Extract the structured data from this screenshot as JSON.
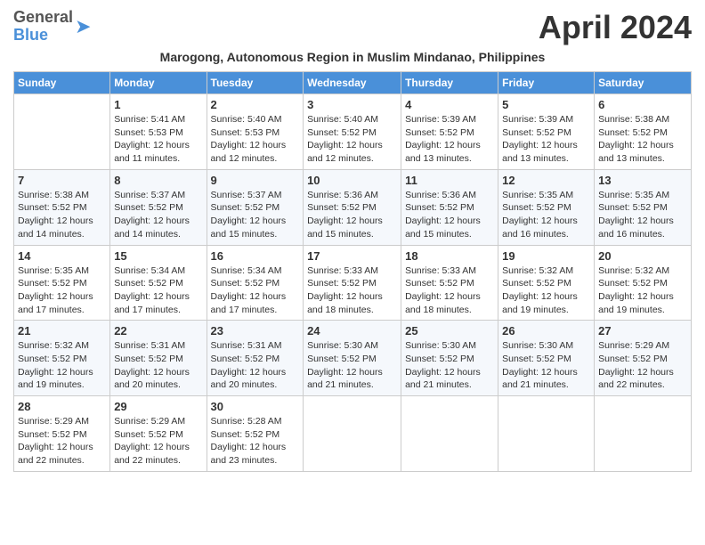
{
  "header": {
    "logo_general": "General",
    "logo_blue": "Blue",
    "month_title": "April 2024",
    "subtitle": "Marogong, Autonomous Region in Muslim Mindanao, Philippines"
  },
  "days_of_week": [
    "Sunday",
    "Monday",
    "Tuesday",
    "Wednesday",
    "Thursday",
    "Friday",
    "Saturday"
  ],
  "weeks": [
    [
      {
        "day": "",
        "sunrise": "",
        "sunset": "",
        "daylight": ""
      },
      {
        "day": "1",
        "sunrise": "Sunrise: 5:41 AM",
        "sunset": "Sunset: 5:53 PM",
        "daylight": "Daylight: 12 hours and 11 minutes."
      },
      {
        "day": "2",
        "sunrise": "Sunrise: 5:40 AM",
        "sunset": "Sunset: 5:53 PM",
        "daylight": "Daylight: 12 hours and 12 minutes."
      },
      {
        "day": "3",
        "sunrise": "Sunrise: 5:40 AM",
        "sunset": "Sunset: 5:52 PM",
        "daylight": "Daylight: 12 hours and 12 minutes."
      },
      {
        "day": "4",
        "sunrise": "Sunrise: 5:39 AM",
        "sunset": "Sunset: 5:52 PM",
        "daylight": "Daylight: 12 hours and 13 minutes."
      },
      {
        "day": "5",
        "sunrise": "Sunrise: 5:39 AM",
        "sunset": "Sunset: 5:52 PM",
        "daylight": "Daylight: 12 hours and 13 minutes."
      },
      {
        "day": "6",
        "sunrise": "Sunrise: 5:38 AM",
        "sunset": "Sunset: 5:52 PM",
        "daylight": "Daylight: 12 hours and 13 minutes."
      }
    ],
    [
      {
        "day": "7",
        "sunrise": "Sunrise: 5:38 AM",
        "sunset": "Sunset: 5:52 PM",
        "daylight": "Daylight: 12 hours and 14 minutes."
      },
      {
        "day": "8",
        "sunrise": "Sunrise: 5:37 AM",
        "sunset": "Sunset: 5:52 PM",
        "daylight": "Daylight: 12 hours and 14 minutes."
      },
      {
        "day": "9",
        "sunrise": "Sunrise: 5:37 AM",
        "sunset": "Sunset: 5:52 PM",
        "daylight": "Daylight: 12 hours and 15 minutes."
      },
      {
        "day": "10",
        "sunrise": "Sunrise: 5:36 AM",
        "sunset": "Sunset: 5:52 PM",
        "daylight": "Daylight: 12 hours and 15 minutes."
      },
      {
        "day": "11",
        "sunrise": "Sunrise: 5:36 AM",
        "sunset": "Sunset: 5:52 PM",
        "daylight": "Daylight: 12 hours and 15 minutes."
      },
      {
        "day": "12",
        "sunrise": "Sunrise: 5:35 AM",
        "sunset": "Sunset: 5:52 PM",
        "daylight": "Daylight: 12 hours and 16 minutes."
      },
      {
        "day": "13",
        "sunrise": "Sunrise: 5:35 AM",
        "sunset": "Sunset: 5:52 PM",
        "daylight": "Daylight: 12 hours and 16 minutes."
      }
    ],
    [
      {
        "day": "14",
        "sunrise": "Sunrise: 5:35 AM",
        "sunset": "Sunset: 5:52 PM",
        "daylight": "Daylight: 12 hours and 17 minutes."
      },
      {
        "day": "15",
        "sunrise": "Sunrise: 5:34 AM",
        "sunset": "Sunset: 5:52 PM",
        "daylight": "Daylight: 12 hours and 17 minutes."
      },
      {
        "day": "16",
        "sunrise": "Sunrise: 5:34 AM",
        "sunset": "Sunset: 5:52 PM",
        "daylight": "Daylight: 12 hours and 17 minutes."
      },
      {
        "day": "17",
        "sunrise": "Sunrise: 5:33 AM",
        "sunset": "Sunset: 5:52 PM",
        "daylight": "Daylight: 12 hours and 18 minutes."
      },
      {
        "day": "18",
        "sunrise": "Sunrise: 5:33 AM",
        "sunset": "Sunset: 5:52 PM",
        "daylight": "Daylight: 12 hours and 18 minutes."
      },
      {
        "day": "19",
        "sunrise": "Sunrise: 5:32 AM",
        "sunset": "Sunset: 5:52 PM",
        "daylight": "Daylight: 12 hours and 19 minutes."
      },
      {
        "day": "20",
        "sunrise": "Sunrise: 5:32 AM",
        "sunset": "Sunset: 5:52 PM",
        "daylight": "Daylight: 12 hours and 19 minutes."
      }
    ],
    [
      {
        "day": "21",
        "sunrise": "Sunrise: 5:32 AM",
        "sunset": "Sunset: 5:52 PM",
        "daylight": "Daylight: 12 hours and 19 minutes."
      },
      {
        "day": "22",
        "sunrise": "Sunrise: 5:31 AM",
        "sunset": "Sunset: 5:52 PM",
        "daylight": "Daylight: 12 hours and 20 minutes."
      },
      {
        "day": "23",
        "sunrise": "Sunrise: 5:31 AM",
        "sunset": "Sunset: 5:52 PM",
        "daylight": "Daylight: 12 hours and 20 minutes."
      },
      {
        "day": "24",
        "sunrise": "Sunrise: 5:30 AM",
        "sunset": "Sunset: 5:52 PM",
        "daylight": "Daylight: 12 hours and 21 minutes."
      },
      {
        "day": "25",
        "sunrise": "Sunrise: 5:30 AM",
        "sunset": "Sunset: 5:52 PM",
        "daylight": "Daylight: 12 hours and 21 minutes."
      },
      {
        "day": "26",
        "sunrise": "Sunrise: 5:30 AM",
        "sunset": "Sunset: 5:52 PM",
        "daylight": "Daylight: 12 hours and 21 minutes."
      },
      {
        "day": "27",
        "sunrise": "Sunrise: 5:29 AM",
        "sunset": "Sunset: 5:52 PM",
        "daylight": "Daylight: 12 hours and 22 minutes."
      }
    ],
    [
      {
        "day": "28",
        "sunrise": "Sunrise: 5:29 AM",
        "sunset": "Sunset: 5:52 PM",
        "daylight": "Daylight: 12 hours and 22 minutes."
      },
      {
        "day": "29",
        "sunrise": "Sunrise: 5:29 AM",
        "sunset": "Sunset: 5:52 PM",
        "daylight": "Daylight: 12 hours and 22 minutes."
      },
      {
        "day": "30",
        "sunrise": "Sunrise: 5:28 AM",
        "sunset": "Sunset: 5:52 PM",
        "daylight": "Daylight: 12 hours and 23 minutes."
      },
      {
        "day": "",
        "sunrise": "",
        "sunset": "",
        "daylight": ""
      },
      {
        "day": "",
        "sunrise": "",
        "sunset": "",
        "daylight": ""
      },
      {
        "day": "",
        "sunrise": "",
        "sunset": "",
        "daylight": ""
      },
      {
        "day": "",
        "sunrise": "",
        "sunset": "",
        "daylight": ""
      }
    ]
  ]
}
